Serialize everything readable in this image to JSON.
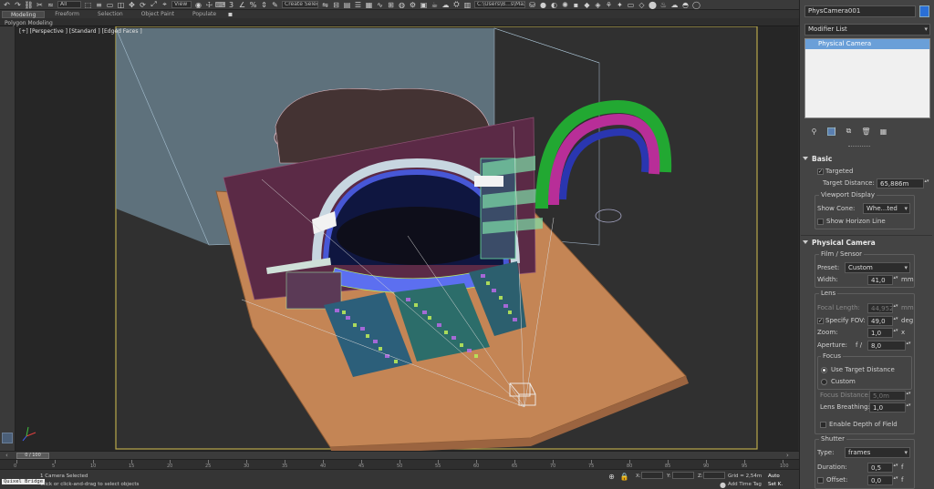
{
  "toolbar": {
    "selection_filter": "All",
    "view_combo": "View",
    "named_selection": "Create Selection Se",
    "project_path": "C:\\Users\\B...s\\Max 2020"
  },
  "ribbon": {
    "tabs": [
      "Modeling",
      "Freeform",
      "Selection",
      "Object Paint",
      "Populate"
    ],
    "active_tab": "Modeling",
    "sub_label": "Polygon Modeling"
  },
  "viewport": {
    "label": "[+] [Perspective ] [Standard ] [Edged Faces ]"
  },
  "command_panel": {
    "object_name": "PhysCamera001",
    "object_color": "#2a6fd6",
    "modifier_list_label": "Modifier List",
    "modifier_stack": [
      "Physical Camera"
    ],
    "rollouts": {
      "basic": {
        "title": "Basic",
        "targeted_label": "Targeted",
        "targeted_checked": true,
        "target_distance_label": "Target Distance:",
        "target_distance_value": "65,886m",
        "viewport_display_label": "Viewport Display",
        "show_cone_label": "Show Cone:",
        "show_cone_value": "Whe...ted",
        "show_horizon_label": "Show Horizon Line"
      },
      "physical_camera": {
        "title": "Physical Camera",
        "film_sensor_label": "Film / Sensor",
        "preset_label": "Preset:",
        "preset_value": "Custom",
        "width_label": "Width:",
        "width_value": "41,0",
        "width_unit": "mm",
        "lens_label": "Lens",
        "focal_length_label": "Focal Length:",
        "focal_length_value": "44,952",
        "focal_length_unit": "mm",
        "specify_fov_label": "Specify FOV:",
        "specify_fov_value": "49,0",
        "specify_fov_unit": "deg",
        "zoom_label": "Zoom:",
        "zoom_value": "1,0",
        "zoom_unit": "x",
        "aperture_label": "Aperture:",
        "aperture_prefix": "f /",
        "aperture_value": "8,0",
        "focus_label": "Focus",
        "use_target_distance_label": "Use Target Distance",
        "custom_label": "Custom",
        "focus_distance_label": "Focus Distance:",
        "focus_distance_value": "5,0m",
        "lens_breathing_label": "Lens Breathing:",
        "lens_breathing_value": "1,0",
        "enable_dof_label": "Enable Depth of Field",
        "shutter_label": "Shutter",
        "type_label": "Type:",
        "type_value": "frames",
        "duration_label": "Duration:",
        "duration_value": "0,5",
        "duration_unit": "f",
        "offset_label": "Offset:",
        "offset_value": "0,0",
        "offset_unit": "f"
      }
    }
  },
  "timeline": {
    "frame_counter": "0 / 100",
    "ruler_labels": [
      "0",
      "5",
      "10",
      "15",
      "20",
      "25",
      "30",
      "35",
      "40",
      "45",
      "50",
      "55",
      "60",
      "65",
      "70",
      "75",
      "80",
      "85",
      "90",
      "95",
      "100"
    ]
  },
  "statusbar": {
    "script_label": "Quixel Bridge",
    "selection_status": "1 Camera Selected",
    "prompt": "Click or click-and-drag to select objects",
    "x_label": "X:",
    "y_label": "Y:",
    "z_label": "Z:",
    "grid_label": "Grid = 2,54m",
    "add_time_tag": "Add Time Tag",
    "auto_key": "Auto",
    "set_key": "Set K."
  }
}
